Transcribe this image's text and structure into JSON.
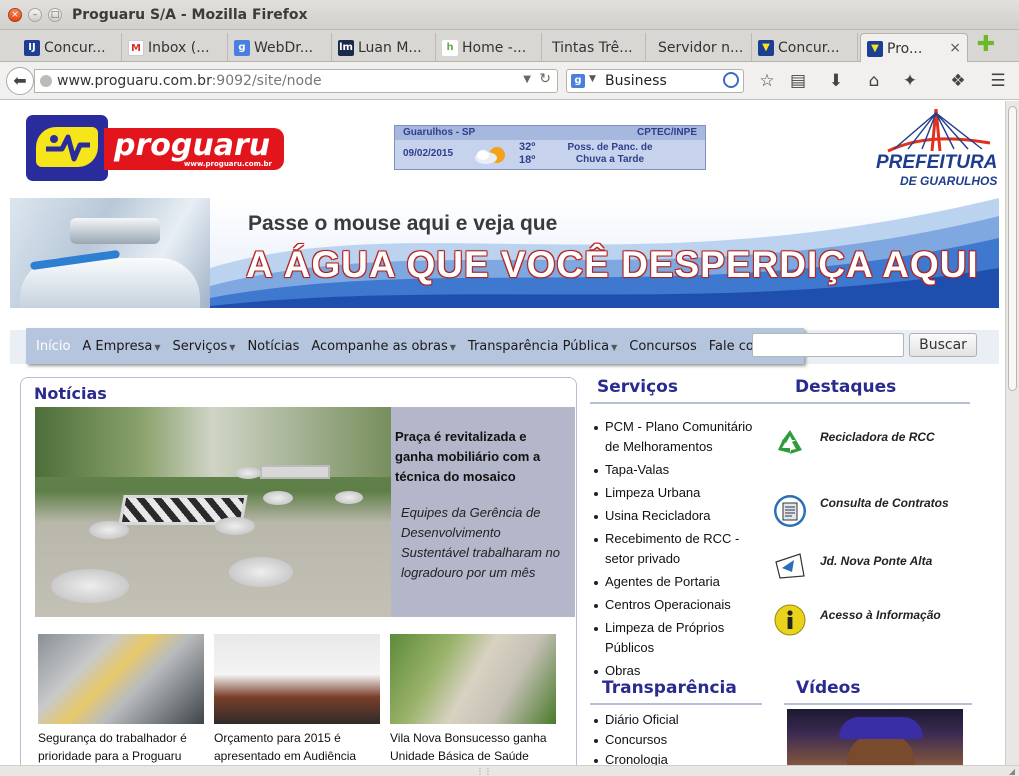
{
  "window": {
    "title": "Proguaru S/A - Mozilla Firefox",
    "close": "×",
    "min": "–",
    "max": "□"
  },
  "tabs": [
    {
      "label": "Concur...",
      "icon": "concur-favicon"
    },
    {
      "label": "Inbox (...",
      "icon": "gmail-favicon"
    },
    {
      "label": "WebDr...",
      "icon": "google-favicon"
    },
    {
      "label": "Luan M...",
      "icon": "lm-favicon"
    },
    {
      "label": "Home -...",
      "icon": "hr-favicon"
    },
    {
      "label": "Tintas Trê...",
      "icon": "none"
    },
    {
      "label": "Servidor n...",
      "icon": "none"
    },
    {
      "label": "Concur...",
      "icon": "concur-favicon"
    },
    {
      "label": "Pro...",
      "icon": "proguaru-favicon",
      "close": "×"
    }
  ],
  "nav": {
    "url_host": "www.proguaru.com.br",
    "url_rest": ":9092/site/node",
    "search_engine": "g",
    "search_value": "Business",
    "toolbar_icons": [
      "star-icon",
      "reading-list-icon",
      "download-icon",
      "home-icon",
      "addon-icon",
      "sync-icon",
      "menu-icon"
    ]
  },
  "header": {
    "logo_text": "proguaru",
    "logo_url": "www.proguaru.com.br",
    "weather": {
      "city": "Guarulhos - SP",
      "source": "CPTEC/INPE",
      "date": "09/02/2015",
      "max": "32º",
      "min": "18º",
      "desc": "Poss. de Panc. de Chuva a Tarde"
    },
    "prefeitura_1": "PREFEITURA",
    "prefeitura_2": "DE GUARULHOS"
  },
  "banner": {
    "line1": "Passe o mouse aqui e veja que",
    "line2": "A ÁGUA QUE VOCÊ DESPERDIÇA AQUI"
  },
  "menu": {
    "items": [
      {
        "label": "Início",
        "arrow": ""
      },
      {
        "label": "A Empresa",
        "arrow": "▼"
      },
      {
        "label": "Serviços",
        "arrow": "▼"
      },
      {
        "label": "Notícias",
        "arrow": ""
      },
      {
        "label": "Acompanhe as obras",
        "arrow": "▼"
      },
      {
        "label": "Transparência Pública",
        "arrow": "▼"
      },
      {
        "label": "Concursos",
        "arrow": ""
      },
      {
        "label": "Fale conosco",
        "arrow": ""
      }
    ],
    "search_button": "Buscar"
  },
  "news": {
    "title": "Notícias",
    "featured_head": "Praça é revitalizada e ganha mobiliário com a técnica do mosaico",
    "featured_sub": "Equipes da Gerência de Desenvolvimento Sustentável trabalharam no logradouro por um mês",
    "thumbs": [
      {
        "caption": "Segurança do trabalhador é prioridade para a Proguaru"
      },
      {
        "caption": "Orçamento para 2015 é apresentado em Audiência"
      },
      {
        "caption": "Vila Nova Bonsucesso ganha Unidade Básica de Saúde"
      }
    ]
  },
  "services": {
    "title": "Serviços",
    "items": [
      "PCM - Plano Comunitário de Melhoramentos",
      "Tapa-Valas",
      "Limpeza Urbana",
      "Usina Recicladora",
      "Recebimento de RCC - setor privado",
      "Agentes de Portaria",
      "Centros Operacionais",
      "Limpeza de Próprios Públicos",
      "Obras"
    ]
  },
  "highlights": {
    "title": "Destaques",
    "items": [
      {
        "label": "Recicladora de RCC",
        "icon": "recycle-icon"
      },
      {
        "label": "Consulta de Contratos",
        "icon": "contracts-icon"
      },
      {
        "label": "Jd. Nova Ponte Alta",
        "icon": "arrow-sign-icon"
      },
      {
        "label": "Acesso à Informação",
        "icon": "info-icon"
      }
    ]
  },
  "transparency": {
    "title": "Transparência",
    "items": [
      "Diário Oficial",
      "Concursos",
      "Cronologia"
    ]
  },
  "videos": {
    "title": "Vídeos"
  }
}
